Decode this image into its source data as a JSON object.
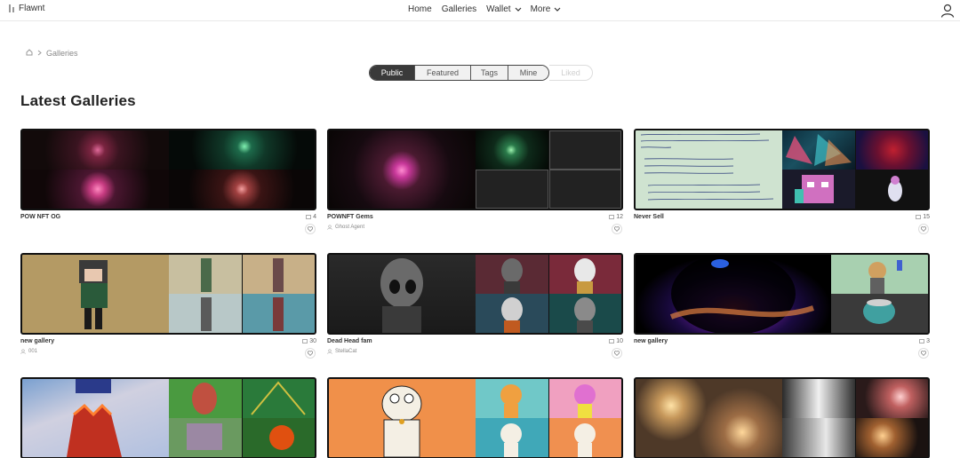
{
  "brand": {
    "name": "Flawnt",
    "icon": "flawnt-logo-icon"
  },
  "nav": {
    "home": "Home",
    "galleries": "Galleries",
    "wallet": "Wallet",
    "more": "More"
  },
  "user_icon": "user-icon",
  "breadcrumb": {
    "home_icon": "home-icon",
    "current": "Galleries"
  },
  "tabs": [
    {
      "label": "Public",
      "active": true
    },
    {
      "label": "Featured",
      "active": false
    },
    {
      "label": "Tags",
      "active": false
    },
    {
      "label": "Mine",
      "active": false
    },
    {
      "label": "Liked",
      "disabled": true
    }
  ],
  "page_title": "Latest Galleries",
  "galleries": [
    {
      "name": "POW NFT OG",
      "count": "4",
      "owner": ""
    },
    {
      "name": "POWNFT Gems",
      "count": "12",
      "owner": "Ghost Agent"
    },
    {
      "name": "Never Sell",
      "count": "15",
      "owner": ""
    },
    {
      "name": "new gallery",
      "count": "30",
      "owner": "001"
    },
    {
      "name": "Dead Head fam",
      "count": "10",
      "owner": "StellaCat"
    },
    {
      "name": "new gallery",
      "count": "3",
      "owner": ""
    },
    {
      "name": "",
      "count": "",
      "owner": ""
    },
    {
      "name": "",
      "count": "",
      "owner": ""
    },
    {
      "name": "",
      "count": "",
      "owner": ""
    }
  ],
  "handwritten_note": [
    "Greek nose and amber brown skin",
    "Kind green eyes and a comet hairstyle",
    "And that",
    "Sugar cane background",
    "Sugar cane background",
    "Sugar cane background",
    "My daughter takes our share",
    "My daughter makes me feel",
    "Just the stuff that long blonde hair"
  ]
}
